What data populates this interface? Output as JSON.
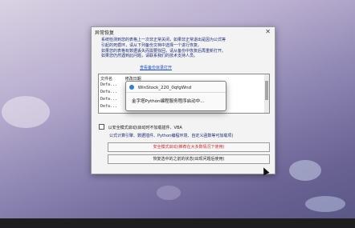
{
  "dialog": {
    "title": "异常恢复",
    "message_line1": "系统检测到您的表格上一次非正常关闭，如果非正常退出是因为公式等",
    "message_line2": "引起的死循环，请从下列备份文档中选择一个进行恢复。",
    "message_line3": "如果您的表格有数据丢失而需要找回，请从备份中恢复后再重新打开。",
    "message_line4": "如果您仍然遇到此问题，请联系我们的技术支持人员。",
    "link_label": "查看备份目录打开",
    "file_list": {
      "headers": [
        "文件名",
        "修改日期"
      ],
      "rows": [
        "Defa...",
        "Defa...",
        "Defa...",
        "Defa..."
      ]
    },
    "checkbox_label": "以安全模式启动(启动时不加载插件、VBA",
    "info_line": "公式计算引擎、数据插件、Python编程环境、自定义函数等可加载项)",
    "safe_mode_button": "安全模式启动(推荐在大多数情况下使用)",
    "restore_button": "恢复选中的之前的状态(出现问题后使用)",
    "close_icon": "close-icon"
  },
  "popup": {
    "title": "WinStock_220_0qfgWnd",
    "message": "金字塔Python编程服务程序启动中..."
  }
}
